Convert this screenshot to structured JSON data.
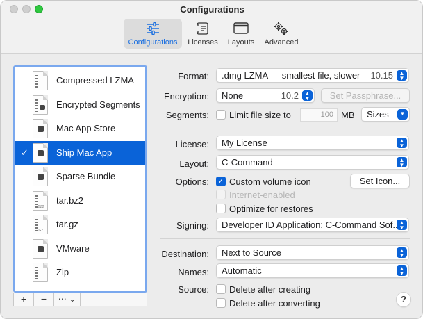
{
  "window": {
    "title": "Configurations"
  },
  "toolbar": {
    "items": [
      {
        "label": "Configurations",
        "icon": "sliders-icon",
        "active": true
      },
      {
        "label": "Licenses",
        "icon": "scroll-icon",
        "active": false
      },
      {
        "label": "Layouts",
        "icon": "window-icon",
        "active": false
      },
      {
        "label": "Advanced",
        "icon": "gears-icon",
        "active": false
      }
    ]
  },
  "sidebar": {
    "items": [
      {
        "label": "Compressed LZMA",
        "icon": "zipped-document-icon",
        "selected": false
      },
      {
        "label": "Encrypted Segments",
        "icon": "locked-document-icon",
        "selected": false
      },
      {
        "label": "Mac App Store",
        "icon": "app-store-document-icon",
        "selected": false
      },
      {
        "label": "Ship Mac App",
        "icon": "app-document-icon",
        "selected": true,
        "check": "✓"
      },
      {
        "label": "Sparse Bundle",
        "icon": "document-icon",
        "selected": false
      },
      {
        "label": "tar.bz2",
        "icon": "archive-document-icon",
        "ext": "BZ2",
        "selected": false
      },
      {
        "label": "tar.gz",
        "icon": "archive-document-icon",
        "ext": "GZ",
        "selected": false
      },
      {
        "label": "VMware",
        "icon": "vm-document-icon",
        "selected": false
      },
      {
        "label": "Zip",
        "icon": "zip-document-icon",
        "selected": false
      }
    ],
    "controls": {
      "add": "+",
      "remove": "−",
      "more": "⋯ ⌄"
    }
  },
  "form": {
    "format": {
      "label": "Format:",
      "value": ".dmg LZMA — smallest file, slower",
      "version": "10.15"
    },
    "encryption": {
      "label": "Encryption:",
      "value": "None",
      "version": "10.2",
      "passphrase_button": "Set Passphrase..."
    },
    "segments": {
      "label": "Segments:",
      "checkbox_label": "Limit file size to",
      "size_value": "100",
      "unit": "MB",
      "popup": "Sizes"
    },
    "license": {
      "label": "License:",
      "value": "My License"
    },
    "layout": {
      "label": "Layout:",
      "value": "C-Command"
    },
    "options": {
      "label": "Options:",
      "custom_icon": "Custom volume icon",
      "set_icon_button": "Set Icon...",
      "internet_enabled": "Internet-enabled",
      "optimize": "Optimize for restores"
    },
    "signing": {
      "label": "Signing:",
      "value": "Developer ID Application: C-Command Sof..."
    },
    "destination": {
      "label": "Destination:",
      "value": "Next to Source"
    },
    "names": {
      "label": "Names:",
      "value": "Automatic"
    },
    "source": {
      "label": "Source:",
      "delete_after_creating": "Delete after creating",
      "delete_after_converting": "Delete after converting"
    },
    "help": "?"
  },
  "colors": {
    "accent": "#0a63d8",
    "focus_ring": "#7aa8ee"
  }
}
